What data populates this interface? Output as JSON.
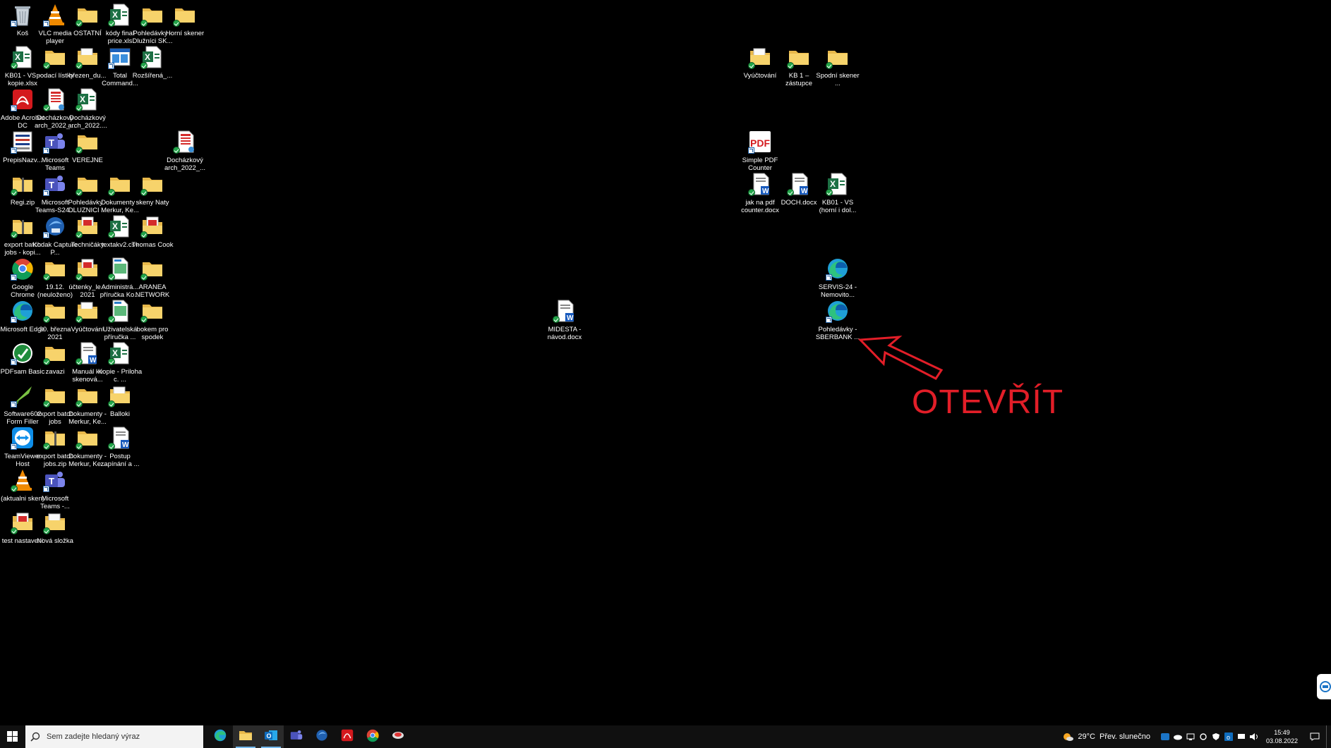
{
  "desktop": {
    "icons": [
      {
        "label": "Koš",
        "icon": "recycle-bin-icon",
        "col": 0,
        "row": 0
      },
      {
        "label": "VLC media player",
        "icon": "vlc-icon",
        "col": 1,
        "row": 0
      },
      {
        "label": "OSTATNÍ",
        "icon": "folder-icon",
        "col": 2,
        "row": 0,
        "sync": true
      },
      {
        "label": "kódy final price.xls",
        "icon": "excel-icon",
        "col": 3,
        "row": 0,
        "sync": true
      },
      {
        "label": "Pohledávky - Dlužníci SK...",
        "icon": "folder-icon",
        "col": 4,
        "row": 0,
        "sync": true
      },
      {
        "label": "Horní skener",
        "icon": "folder-icon",
        "col": 5,
        "row": 0,
        "sync": true
      },
      {
        "label": "KB01 - VS - kopie.xlsx",
        "icon": "excel-icon",
        "col": 0,
        "row": 1,
        "sync": true
      },
      {
        "label": "podací lístky",
        "icon": "folder-icon",
        "col": 1,
        "row": 1,
        "sync": true
      },
      {
        "label": "březen_du...",
        "icon": "folder-docs-icon",
        "col": 2,
        "row": 1,
        "sync": true
      },
      {
        "label": "Total Command...",
        "icon": "total-commander-icon",
        "col": 3,
        "row": 1
      },
      {
        "label": "Rozšířená_...",
        "icon": "excel-icon",
        "col": 4,
        "row": 1,
        "sync": true
      },
      {
        "label": "Adobe Acrobat DC",
        "icon": "acrobat-icon",
        "col": 0,
        "row": 2
      },
      {
        "label": "Docházkový arch_2022_...",
        "icon": "pdf-doc-icon",
        "col": 1,
        "row": 2,
        "sync": true
      },
      {
        "label": "Docházkový arch_2022....",
        "icon": "excel-icon",
        "col": 2,
        "row": 2,
        "sync": true
      },
      {
        "label": "PrepisNazv...",
        "icon": "app-list-icon",
        "col": 0,
        "row": 3
      },
      {
        "label": "Microsoft Teams",
        "icon": "teams-icon",
        "col": 1,
        "row": 3
      },
      {
        "label": "VEREJNE",
        "icon": "folder-icon",
        "col": 2,
        "row": 3,
        "sync": true
      },
      {
        "label": "Docházkový arch_2022_...",
        "icon": "pdf-doc-icon",
        "col": 5,
        "row": 3,
        "sync": true
      },
      {
        "label": "Regi.zip",
        "icon": "zip-folder-icon",
        "col": 0,
        "row": 4,
        "sync": true
      },
      {
        "label": "Microsoft Teams-S24...",
        "icon": "teams-icon",
        "col": 1,
        "row": 4
      },
      {
        "label": "Pohledávky - DLUZNICI ...",
        "icon": "folder-icon",
        "col": 2,
        "row": 4,
        "sync": true
      },
      {
        "label": "Dokumenty - Merkur, Ke...",
        "icon": "folder-icon",
        "col": 3,
        "row": 4,
        "sync": true
      },
      {
        "label": "skeny Naty",
        "icon": "folder-icon",
        "col": 4,
        "row": 4,
        "sync": true
      },
      {
        "label": "export batch jobs - kopi...",
        "icon": "zip-folder-icon",
        "col": 0,
        "row": 5,
        "sync": true
      },
      {
        "label": "Kodak Capture P...",
        "icon": "kodak-icon",
        "col": 1,
        "row": 5
      },
      {
        "label": "Techničáky",
        "icon": "pdf-folder-icon",
        "col": 2,
        "row": 5,
        "sync": true
      },
      {
        "label": "textakv2.csv",
        "icon": "excel-icon",
        "col": 3,
        "row": 5,
        "sync": true
      },
      {
        "label": "Thomas Cook",
        "icon": "pdf-folder-icon",
        "col": 4,
        "row": 5,
        "sync": true
      },
      {
        "label": "Google Chrome",
        "icon": "chrome-icon",
        "col": 0,
        "row": 6
      },
      {
        "label": "19.12. (neuloženo)",
        "icon": "folder-icon",
        "col": 1,
        "row": 6,
        "sync": true
      },
      {
        "label": "účtenky_le... 2021",
        "icon": "pdf-folder-icon",
        "col": 2,
        "row": 6,
        "sync": true
      },
      {
        "label": "Administrá... příručka Ko...",
        "icon": "doc-image-icon",
        "col": 3,
        "row": 6,
        "sync": true
      },
      {
        "label": "ARANEA NETWORK",
        "icon": "folder-icon",
        "col": 4,
        "row": 6,
        "sync": true
      },
      {
        "label": "Microsoft Edge",
        "icon": "edge-icon",
        "col": 0,
        "row": 7
      },
      {
        "label": "30. března 2021",
        "icon": "folder-icon",
        "col": 1,
        "row": 7,
        "sync": true
      },
      {
        "label": "Vyúčtování",
        "icon": "folder-docs-icon",
        "col": 2,
        "row": 7,
        "sync": true
      },
      {
        "label": "Uživatelská příručka ...",
        "icon": "doc-image-icon",
        "col": 3,
        "row": 7,
        "sync": true
      },
      {
        "label": "bokem pro spodek",
        "icon": "folder-icon",
        "col": 4,
        "row": 7,
        "sync": true
      },
      {
        "label": "PDFsam Basic",
        "icon": "pdfsam-icon",
        "col": 0,
        "row": 8
      },
      {
        "label": "zavazi",
        "icon": "folder-icon",
        "col": 1,
        "row": 8,
        "sync": true
      },
      {
        "label": "Manuál ke skenová...",
        "icon": "word-icon",
        "col": 2,
        "row": 8,
        "sync": true
      },
      {
        "label": "Kopie - Priloha c. ...",
        "icon": "excel-icon",
        "col": 3,
        "row": 8,
        "sync": true
      },
      {
        "label": "Software602 Form Filler",
        "icon": "software602-icon",
        "col": 0,
        "row": 9
      },
      {
        "label": "export batch jobs",
        "icon": "folder-icon",
        "col": 1,
        "row": 9,
        "sync": true
      },
      {
        "label": "Dokumenty - Merkur, Ke...",
        "icon": "folder-icon",
        "col": 2,
        "row": 9,
        "sync": true
      },
      {
        "label": "Balloki",
        "icon": "folder-docs-icon",
        "col": 3,
        "row": 9,
        "sync": true
      },
      {
        "label": "TeamViewer Host",
        "icon": "teamviewer-icon",
        "col": 0,
        "row": 10
      },
      {
        "label": "export batch jobs.zip",
        "icon": "zip-folder-icon",
        "col": 1,
        "row": 10,
        "sync": true
      },
      {
        "label": "Dokumenty - Merkur, Ke...",
        "icon": "folder-icon",
        "col": 2,
        "row": 10,
        "sync": true
      },
      {
        "label": "Postup zapínání a ...",
        "icon": "word-icon",
        "col": 3,
        "row": 10,
        "sync": true
      },
      {
        "label": "(aktualni sken)",
        "icon": "vlc-icon",
        "col": 0,
        "row": 11,
        "sync": true
      },
      {
        "label": "Microsoft Teams -...",
        "icon": "teams-icon",
        "col": 1,
        "row": 11
      },
      {
        "label": "test nastaveni",
        "icon": "pdf-folder-icon",
        "col": 0,
        "row": 12,
        "sync": true
      },
      {
        "label": "Nová složka",
        "icon": "folder-docs-icon",
        "col": 1,
        "row": 12,
        "sync": true
      }
    ],
    "right_icons": [
      {
        "label": "Vyúčtování",
        "icon": "folder-docs-icon",
        "pos": "r1c0",
        "sync": true
      },
      {
        "label": "KB 1 – zástupce",
        "icon": "folder-icon",
        "pos": "r1c1",
        "sync": true
      },
      {
        "label": "Spodní skener ...",
        "icon": "folder-icon",
        "pos": "r1c2",
        "sync": true
      },
      {
        "label": "Simple PDF Counter",
        "icon": "simple-pdf-icon",
        "pos": "r3c0"
      },
      {
        "label": "jak na pdf counter.docx",
        "icon": "word-icon",
        "pos": "r4c0",
        "sync": true
      },
      {
        "label": "DOCH.docx",
        "icon": "word-icon",
        "pos": "r4c1",
        "sync": true
      },
      {
        "label": "KB01 - VS (horní i dol...",
        "icon": "excel-icon",
        "pos": "r4c2",
        "sync": true
      },
      {
        "label": "SERVIS-24 - Nemovito...",
        "icon": "edge-icon",
        "pos": "r6c2"
      },
      {
        "label": "Pohledávky - SBERBANK ...",
        "icon": "edge-icon",
        "pos": "r7c2"
      },
      {
        "label": "MIDESTA - návod.docx",
        "icon": "word-icon",
        "pos": "mid",
        "sync": true
      }
    ],
    "annotation": {
      "text": "OTEVŘÍT",
      "color": "#e21e28"
    }
  },
  "taskbar": {
    "search_placeholder": "Sem zadejte hledaný výraz",
    "pinned": [
      "edge-icon",
      "file-explorer-icon",
      "outlook-icon",
      "teams-icon",
      "kodak-icon",
      "acrobat-icon",
      "chrome-icon",
      "app-icon"
    ],
    "weather": {
      "temp": "29°C",
      "desc": "Přev. slunečno"
    },
    "clock": {
      "time": "15:49",
      "date": "03.08.2022"
    }
  }
}
